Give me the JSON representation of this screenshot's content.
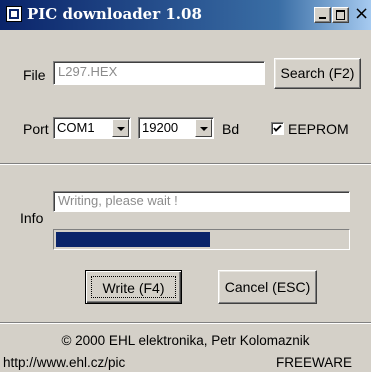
{
  "window": {
    "title": "PIC downloader 1.08",
    "close_glyph": "×"
  },
  "file": {
    "label": "File",
    "value": "L297.HEX",
    "search_button": "Search (F2)"
  },
  "port": {
    "label": "Port",
    "selected": "COM1",
    "baud_selected": "19200",
    "baud_unit": "Bd",
    "eeprom_label": "EEPROM",
    "eeprom_checked": true
  },
  "info": {
    "label": "Info",
    "status_text": "Writing, please wait !",
    "progress_fraction": 0.53
  },
  "actions": {
    "write_button": "Write (F4)",
    "cancel_button": "Cancel (ESC)"
  },
  "footer": {
    "copyright": "© 2000 EHL elektronika, Petr Kolomaznik",
    "url": "http://www.ehl.cz/pic",
    "license": "FREEWARE"
  },
  "colors": {
    "titlebar_start": "#0a246a",
    "titlebar_end": "#a6caf0",
    "progress_fill": "#0a246a",
    "face": "#d4d0c8"
  }
}
